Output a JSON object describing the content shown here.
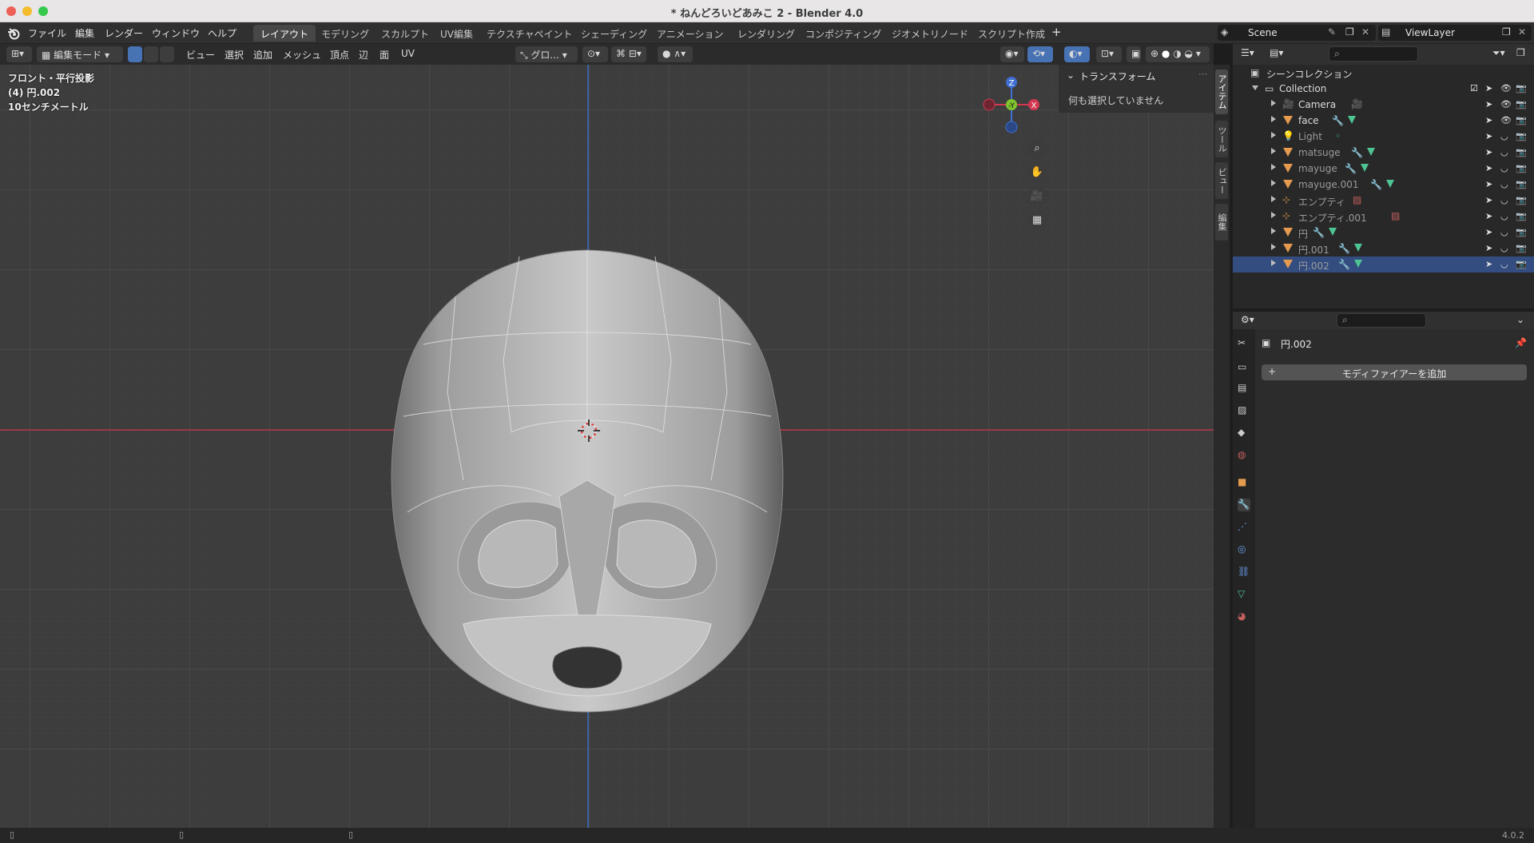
{
  "window": {
    "title": "* ねんどろいどあみこ 2 - Blender 4.0",
    "traffic_colors": [
      "#ee5f56",
      "#f5bd2e",
      "#36c84b"
    ]
  },
  "menu": [
    "ファイル",
    "編集",
    "レンダー",
    "ウィンドウ",
    "ヘルプ"
  ],
  "workspaces": [
    "レイアウト",
    "モデリング",
    "スカルプト",
    "UV編集",
    "テクスチャペイント",
    "シェーディング",
    "アニメーション",
    "レンダリング",
    "コンポジティング",
    "ジオメトリノード",
    "スクリプト作成"
  ],
  "scene": {
    "label": "Scene",
    "view_layer": "ViewLayer"
  },
  "viewport_header": {
    "mode": "編集モード",
    "menus": [
      "ビュー",
      "選択",
      "追加",
      "メッシュ",
      "頂点",
      "辺",
      "面",
      "UV"
    ],
    "transform_orientation": "グロ..."
  },
  "viewport_overlay": {
    "view_name": "フロント・平行投影",
    "object": "(4) 円.002",
    "scale": "10センチメートル"
  },
  "gizmo": {
    "z": "Z",
    "y": "-Y",
    "x": "X"
  },
  "npanel": {
    "section": "トランスフォーム",
    "empty_msg": "何も選択していません",
    "tabs": [
      "アイテム",
      "ツール",
      "ビュー",
      "編集"
    ]
  },
  "outliner": {
    "root": "シーンコレクション",
    "collection": "Collection",
    "items": [
      {
        "name": "Camera",
        "type": "camera",
        "dim": false
      },
      {
        "name": "face",
        "type": "mesh",
        "dim": false
      },
      {
        "name": "Light",
        "type": "light",
        "dim": true
      },
      {
        "name": "matsuge",
        "type": "mesh",
        "dim": true
      },
      {
        "name": "mayuge",
        "type": "mesh",
        "dim": true
      },
      {
        "name": "mayuge.001",
        "type": "mesh",
        "dim": true
      },
      {
        "name": "エンプティ",
        "type": "empty",
        "dim": true
      },
      {
        "name": "エンプティ.001",
        "type": "empty",
        "dim": true
      },
      {
        "name": "円",
        "type": "mesh",
        "dim": true
      },
      {
        "name": "円.001",
        "type": "mesh",
        "dim": true
      },
      {
        "name": "円.002",
        "type": "mesh",
        "dim": true,
        "selected": true
      }
    ]
  },
  "properties": {
    "object_name": "円.002",
    "add_modifier": "モディファイアーを追加"
  },
  "status": {
    "version": "4.0.2"
  }
}
